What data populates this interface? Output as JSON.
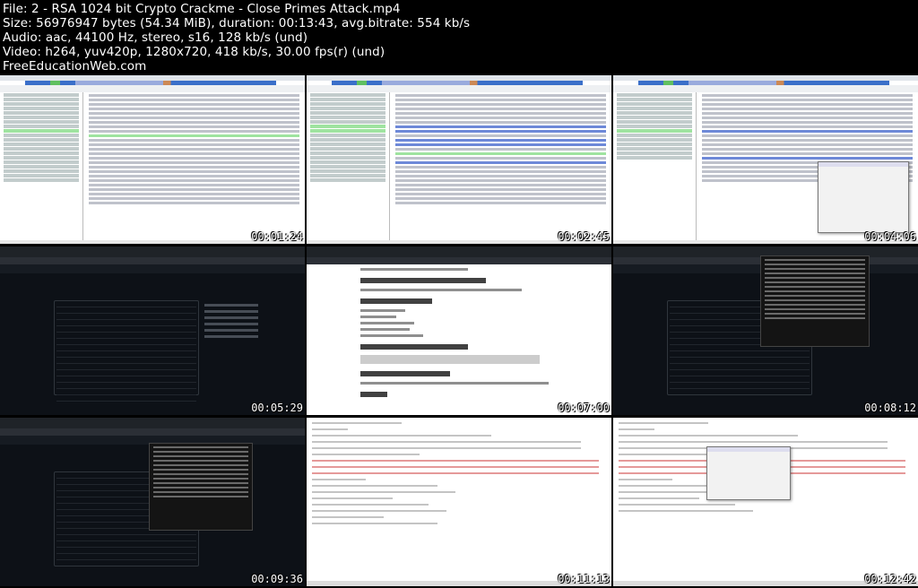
{
  "header": {
    "line1": "File: 2 - RSA 1024 bit Crypto Crackme - Close Primes Attack.mp4",
    "line2": "Size: 56976947 bytes (54.34 MiB), duration: 00:13:43, avg.bitrate: 554 kb/s",
    "line3": "Audio: aac, 44100 Hz, stereo, s16, 128 kb/s (und)",
    "line4": "Video: h264, yuv420p, 1280x720, 418 kb/s, 30.00 fps(r) (und)",
    "line5": "FreeEducationWeb.com"
  },
  "thumbnails": [
    {
      "name": "ida-disassembly-1",
      "timestamp": "00:01:24"
    },
    {
      "name": "ida-comments-1",
      "timestamp": "00:02:45"
    },
    {
      "name": "ida-comments-dialog",
      "timestamp": "00:04:06"
    },
    {
      "name": "github-repo-dark",
      "timestamp": "00:05:29"
    },
    {
      "name": "github-readme-light",
      "timestamp": "00:07:00"
    },
    {
      "name": "github-terminal-overlay",
      "timestamp": "00:08:12"
    },
    {
      "name": "github-terminal-overlay-2",
      "timestamp": "00:09:36"
    },
    {
      "name": "source-code-editor",
      "timestamp": "00:11:13"
    },
    {
      "name": "source-code-dialog",
      "timestamp": "00:12:42"
    }
  ]
}
